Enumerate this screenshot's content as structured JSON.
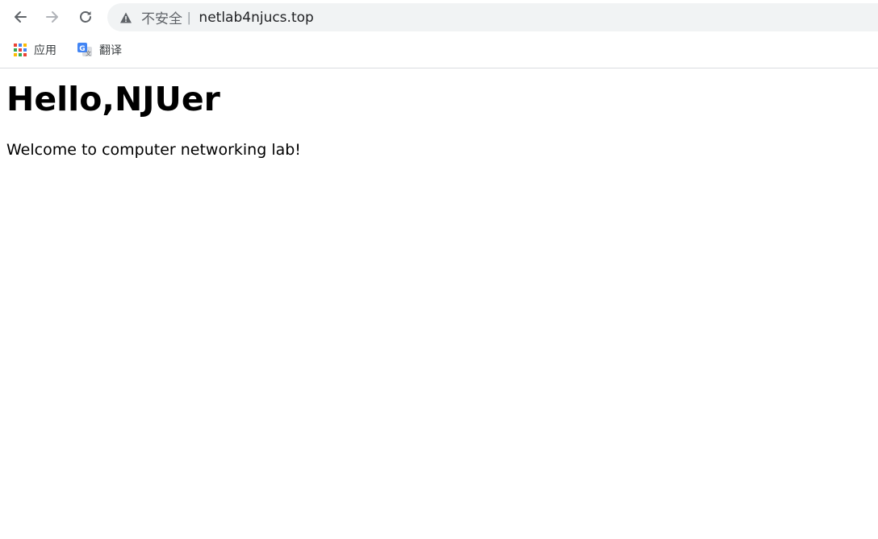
{
  "browser": {
    "security_label": "不安全",
    "separator": "|",
    "url": "netlab4njucs.top",
    "icons": {
      "back": "arrow-left-icon",
      "forward": "arrow-right-icon",
      "reload": "reload-icon",
      "security": "warning-triangle-icon"
    }
  },
  "bookmarks": [
    {
      "label": "应用",
      "icon": "apps-grid-icon"
    },
    {
      "label": "翻译",
      "icon": "google-translate-icon"
    }
  ],
  "page": {
    "heading": "Hello,NJUer",
    "text": "Welcome to computer networking lab!"
  },
  "colors": {
    "omnibox_bg": "#f1f3f4",
    "icon_gray": "#5f6368",
    "text": "#000000"
  }
}
